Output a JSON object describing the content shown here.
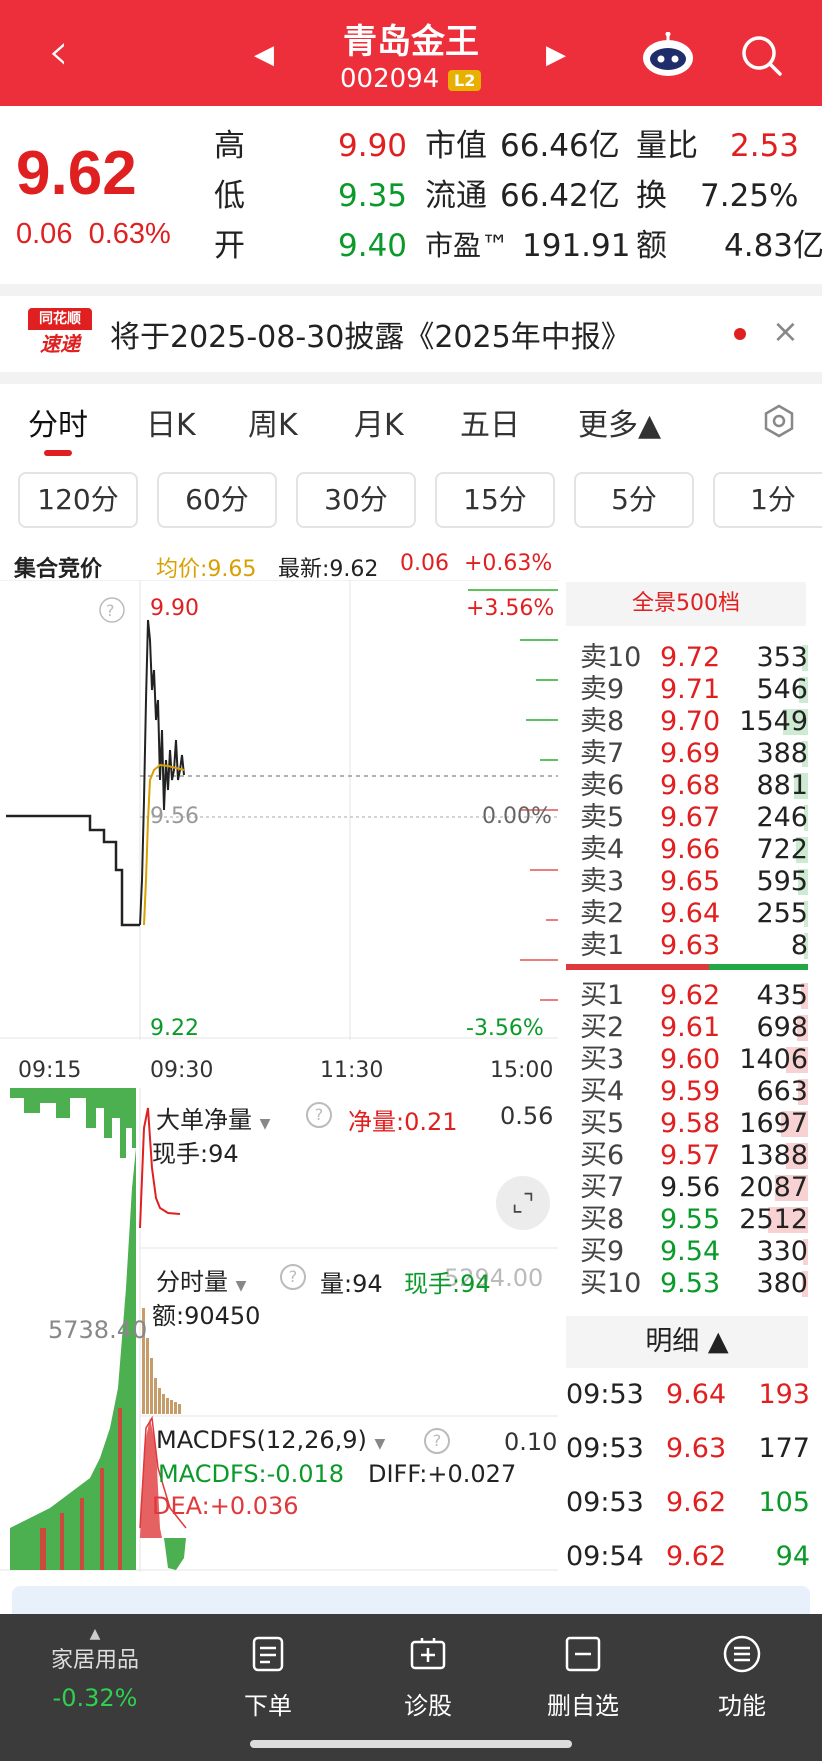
{
  "header": {
    "title": "青岛金王",
    "code": "002094",
    "level": "L2"
  },
  "quote": {
    "price": "9.62",
    "change": "0.06",
    "change_pct": "0.63%",
    "rows": [
      {
        "l1": "高",
        "v1": "9.90",
        "l2": "市值",
        "v2": "66.46亿",
        "l3": "量比",
        "v3": "2.53"
      },
      {
        "l1": "低",
        "v1": "9.35",
        "l2": "流通",
        "v2": "66.42亿",
        "l3": "换",
        "v3": "7.25%"
      },
      {
        "l1": "开",
        "v1": "9.40",
        "l2": "市盈™",
        "v2": "191.91",
        "l3": "额",
        "v3": "4.83亿"
      }
    ]
  },
  "notice": {
    "logo_top": "同花顺",
    "logo_bottom": "速递",
    "text": "将于2025-08-30披露《2025年中报》",
    "close": "×"
  },
  "tabs": [
    "分时",
    "日K",
    "周K",
    "月K",
    "五日",
    "更多▲"
  ],
  "periods": [
    "120分",
    "60分",
    "30分",
    "15分",
    "5分",
    "1分"
  ],
  "chart_header": {
    "auction": "集合竞价",
    "avg": "均价:9.65",
    "latest": "最新:9.62",
    "chg": "0.06",
    "pct": "+0.63%"
  },
  "chart": {
    "y_high": "9.90",
    "y_high_pct": "+3.56%",
    "y_mid": "9.56",
    "y_mid_pct": "0.00%",
    "y_low": "9.22",
    "y_low_pct": "-3.56%",
    "times": [
      "09:15",
      "09:30",
      "11:30",
      "15:00"
    ]
  },
  "indicators": {
    "big": {
      "name": "大单净量",
      "net": "净量:0.21",
      "value": "0.56",
      "hand": "现手:94"
    },
    "vol": {
      "name": "分时量",
      "qty": "量:94",
      "hand": "现手:94",
      "max": "5294.00",
      "amt": "额:90450",
      "left": "5738.40"
    },
    "macd": {
      "name": "MACDFS(12,26,9)",
      "value": "0.10",
      "macdfs": "MACDFS:-0.018",
      "diff": "DIFF:+0.027",
      "dea": "DEA:+0.036"
    }
  },
  "order_book": {
    "title": "全景500档",
    "asks": [
      {
        "label": "卖10",
        "price": "9.72",
        "vol": "353",
        "frac": 0.14
      },
      {
        "label": "卖9",
        "price": "9.71",
        "vol": "546",
        "frac": 0.22
      },
      {
        "label": "卖8",
        "price": "9.70",
        "vol": "1549",
        "frac": 0.62
      },
      {
        "label": "卖7",
        "price": "9.69",
        "vol": "388",
        "frac": 0.16
      },
      {
        "label": "卖6",
        "price": "9.68",
        "vol": "881",
        "frac": 0.35
      },
      {
        "label": "卖5",
        "price": "9.67",
        "vol": "246",
        "frac": 0.1
      },
      {
        "label": "卖4",
        "price": "9.66",
        "vol": "722",
        "frac": 0.29
      },
      {
        "label": "卖3",
        "price": "9.65",
        "vol": "595",
        "frac": 0.24
      },
      {
        "label": "卖2",
        "price": "9.64",
        "vol": "255",
        "frac": 0.1
      },
      {
        "label": "卖1",
        "price": "9.63",
        "vol": "8",
        "frac": 0.01
      }
    ],
    "bids": [
      {
        "label": "买1",
        "price": "9.62",
        "vol": "435",
        "frac": 0.17
      },
      {
        "label": "买2",
        "price": "9.61",
        "vol": "698",
        "frac": 0.28
      },
      {
        "label": "买3",
        "price": "9.60",
        "vol": "1406",
        "frac": 0.56
      },
      {
        "label": "买4",
        "price": "9.59",
        "vol": "663",
        "frac": 0.26
      },
      {
        "label": "买5",
        "price": "9.58",
        "vol": "1697",
        "frac": 0.68
      },
      {
        "label": "买6",
        "price": "9.57",
        "vol": "1388",
        "frac": 0.55
      },
      {
        "label": "买7",
        "price": "9.56",
        "vol": "2087",
        "frac": 0.83
      },
      {
        "label": "买8",
        "price": "9.55",
        "vol": "2512",
        "frac": 1.0
      },
      {
        "label": "买9",
        "price": "9.54",
        "vol": "330",
        "frac": 0.13
      },
      {
        "label": "买10",
        "price": "9.53",
        "vol": "380",
        "frac": 0.15
      }
    ],
    "detail_title": "明细 ▲",
    "details": [
      {
        "time": "09:53",
        "price": "9.64",
        "vol": "193",
        "dir": "red"
      },
      {
        "time": "09:53",
        "price": "9.63",
        "vol": "177",
        "dir": "dark"
      },
      {
        "time": "09:53",
        "price": "9.62",
        "vol": "105",
        "dir": "green"
      },
      {
        "time": "09:54",
        "price": "9.62",
        "vol": "94",
        "dir": "green"
      }
    ]
  },
  "bottom_nav": {
    "sector": "家居用品",
    "sector_pct": "-0.32%",
    "items": [
      "下单",
      "诊股",
      "删自选",
      "功能"
    ]
  },
  "colors": {
    "header_red": "#ec2f3a",
    "up_red": "#e02020",
    "down_green": "#0a9a2a",
    "avg_yellow": "#d8a000"
  }
}
